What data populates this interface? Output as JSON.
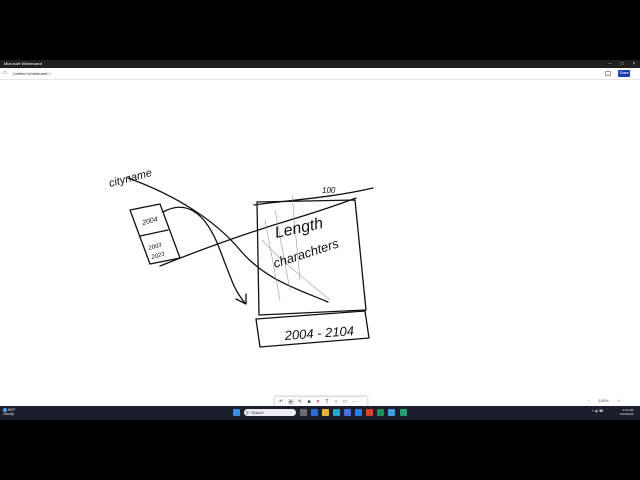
{
  "window": {
    "title": "Microsoft Whiteboard"
  },
  "toolbar": {
    "board_name": "Untitled whiteboard",
    "share_label": "Share"
  },
  "canvas_text": {
    "cityname": "cityname",
    "box_top": "2004",
    "box_bottom_line1": "2003",
    "box_bottom_line2": "2023",
    "length": "Length",
    "characters": "charachters",
    "hundred": "100",
    "range": "2004 - 2104"
  },
  "zoom": {
    "level": "100%"
  },
  "taskbar": {
    "weather_temp": "59°F",
    "weather_desc": "Cloudy",
    "search_placeholder": "Search",
    "time": "4:21 AM",
    "date": "5/13/2024"
  }
}
